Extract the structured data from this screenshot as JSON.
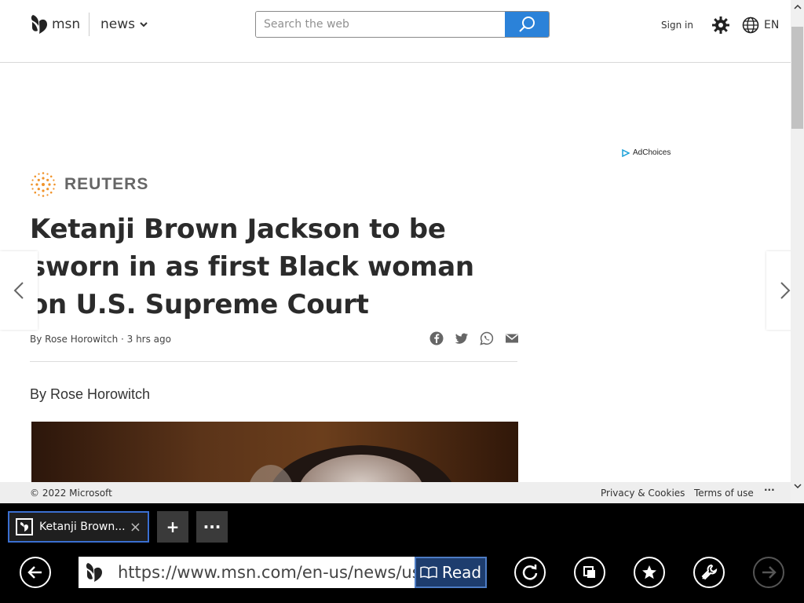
{
  "header": {
    "logo_text": "msn",
    "section_label": "news",
    "search_placeholder": "Search the web",
    "signin_label": "Sign in",
    "lang_label": "EN"
  },
  "ad": {
    "adchoices_label": "AdChoices"
  },
  "article": {
    "source": "REUTERS",
    "headline": "Ketanji Brown Jackson to be sworn in as first Black woman on U.S. Supreme Court",
    "byline_meta": "By Rose Horowitch · 3 hrs ago",
    "byline": "By Rose Horowitch"
  },
  "footer": {
    "copyright": "© 2022 Microsoft",
    "privacy": "Privacy & Cookies",
    "terms": "Terms of use",
    "more": "···"
  },
  "browser": {
    "tab_title": "Ketanji Brown...",
    "tab_close": "×",
    "new_tab": "+",
    "tab_more": "···",
    "url": "https://www.msn.com/en-us/news/us/ke",
    "read_label": "Read"
  },
  "colors": {
    "accent_blue": "#2b82d9",
    "tab_border": "#3a6fd1",
    "reuters_orange": "#f0932b"
  }
}
